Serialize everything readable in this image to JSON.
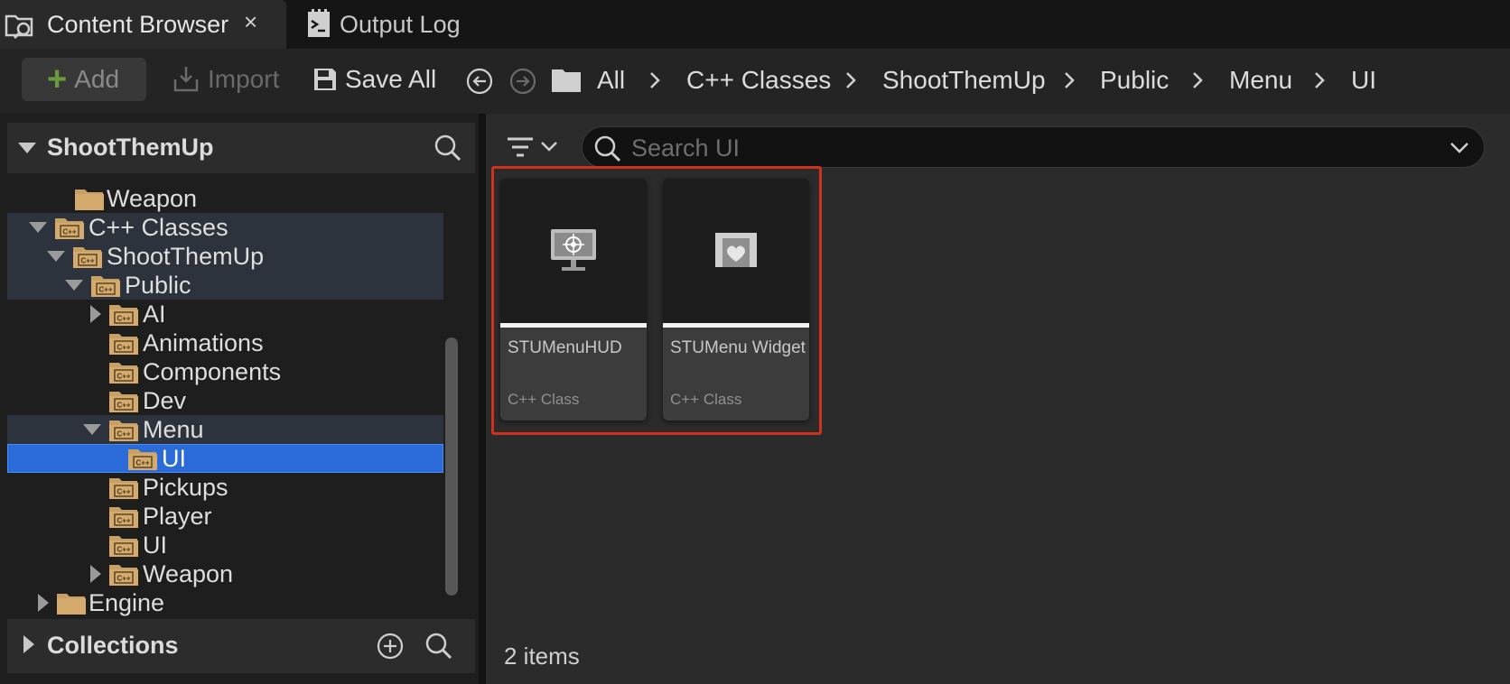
{
  "tabs": [
    {
      "label": "Content Browser",
      "icon": "content-browser-icon",
      "close": "×",
      "active": true
    },
    {
      "label": "Output Log",
      "icon": "output-log-icon",
      "active": false
    }
  ],
  "toolbar": {
    "add_label": "Add",
    "add_symbol": "+",
    "import_label": "Import",
    "save_all_label": "Save All",
    "breadcrumbs": [
      "All",
      "C++ Classes",
      "ShootThemUp",
      "Public",
      "Menu",
      "UI"
    ]
  },
  "sources": {
    "title": "ShootThemUp",
    "tree": [
      {
        "label": "Weapon"
      },
      {
        "label": "C++ Classes"
      },
      {
        "label": "ShootThemUp"
      },
      {
        "label": "Public"
      },
      {
        "label": "AI"
      },
      {
        "label": "Animations"
      },
      {
        "label": "Components"
      },
      {
        "label": "Dev"
      },
      {
        "label": "Menu"
      },
      {
        "label": "UI"
      },
      {
        "label": "Pickups"
      },
      {
        "label": "Player"
      },
      {
        "label": "UI"
      },
      {
        "label": "Weapon"
      },
      {
        "label": "Engine"
      }
    ],
    "collections_title": "Collections"
  },
  "content": {
    "search_placeholder": "Search UI",
    "assets": [
      {
        "name": "STUMenuHUD",
        "type": "C++ Class",
        "icon": "hud-monitor-icon"
      },
      {
        "name": "STUMenu Widget",
        "type": "C++ Class",
        "icon": "widget-icon"
      }
    ],
    "item_count": "2 items"
  },
  "colors": {
    "selection": "#2a6ad9",
    "highlight_border": "#d0311c",
    "folder": "#c9a063",
    "add_plus": "#6b9a3a"
  }
}
